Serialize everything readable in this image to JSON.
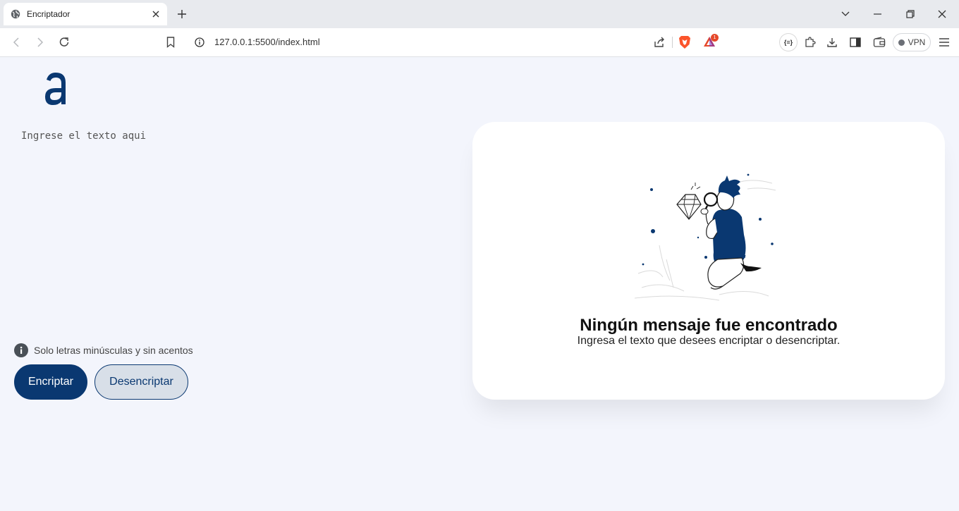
{
  "browser": {
    "tab_title": "Encriptador",
    "url": "127.0.0.1:5500/index.html",
    "rewards_badge": "1",
    "vpn_label": "VPN",
    "ext_label": "{≡}"
  },
  "main": {
    "input_placeholder": "Ingrese el texto aqui",
    "hint": "Solo letras minúsculas y sin acentos",
    "encrypt_label": "Encriptar",
    "decrypt_label": "Desencriptar"
  },
  "output": {
    "title": "Ningún mensaje fue encontrado",
    "subtitle": "Ingresa el texto que desees encriptar o desencriptar."
  },
  "colors": {
    "primary": "#0a3871",
    "page_bg": "#f3f5fc",
    "card_bg": "#ffffff"
  },
  "icons": [
    "globe-icon",
    "close-icon",
    "plus-icon",
    "chevron-down-icon",
    "minimize-icon",
    "restore-icon",
    "back-icon",
    "forward-icon",
    "reload-icon",
    "bookmark-icon",
    "info-icon",
    "share-icon",
    "brave-shield-icon",
    "rewards-icon",
    "extensions-icon",
    "download-icon",
    "sidebar-icon",
    "wallet-icon",
    "menu-icon"
  ]
}
